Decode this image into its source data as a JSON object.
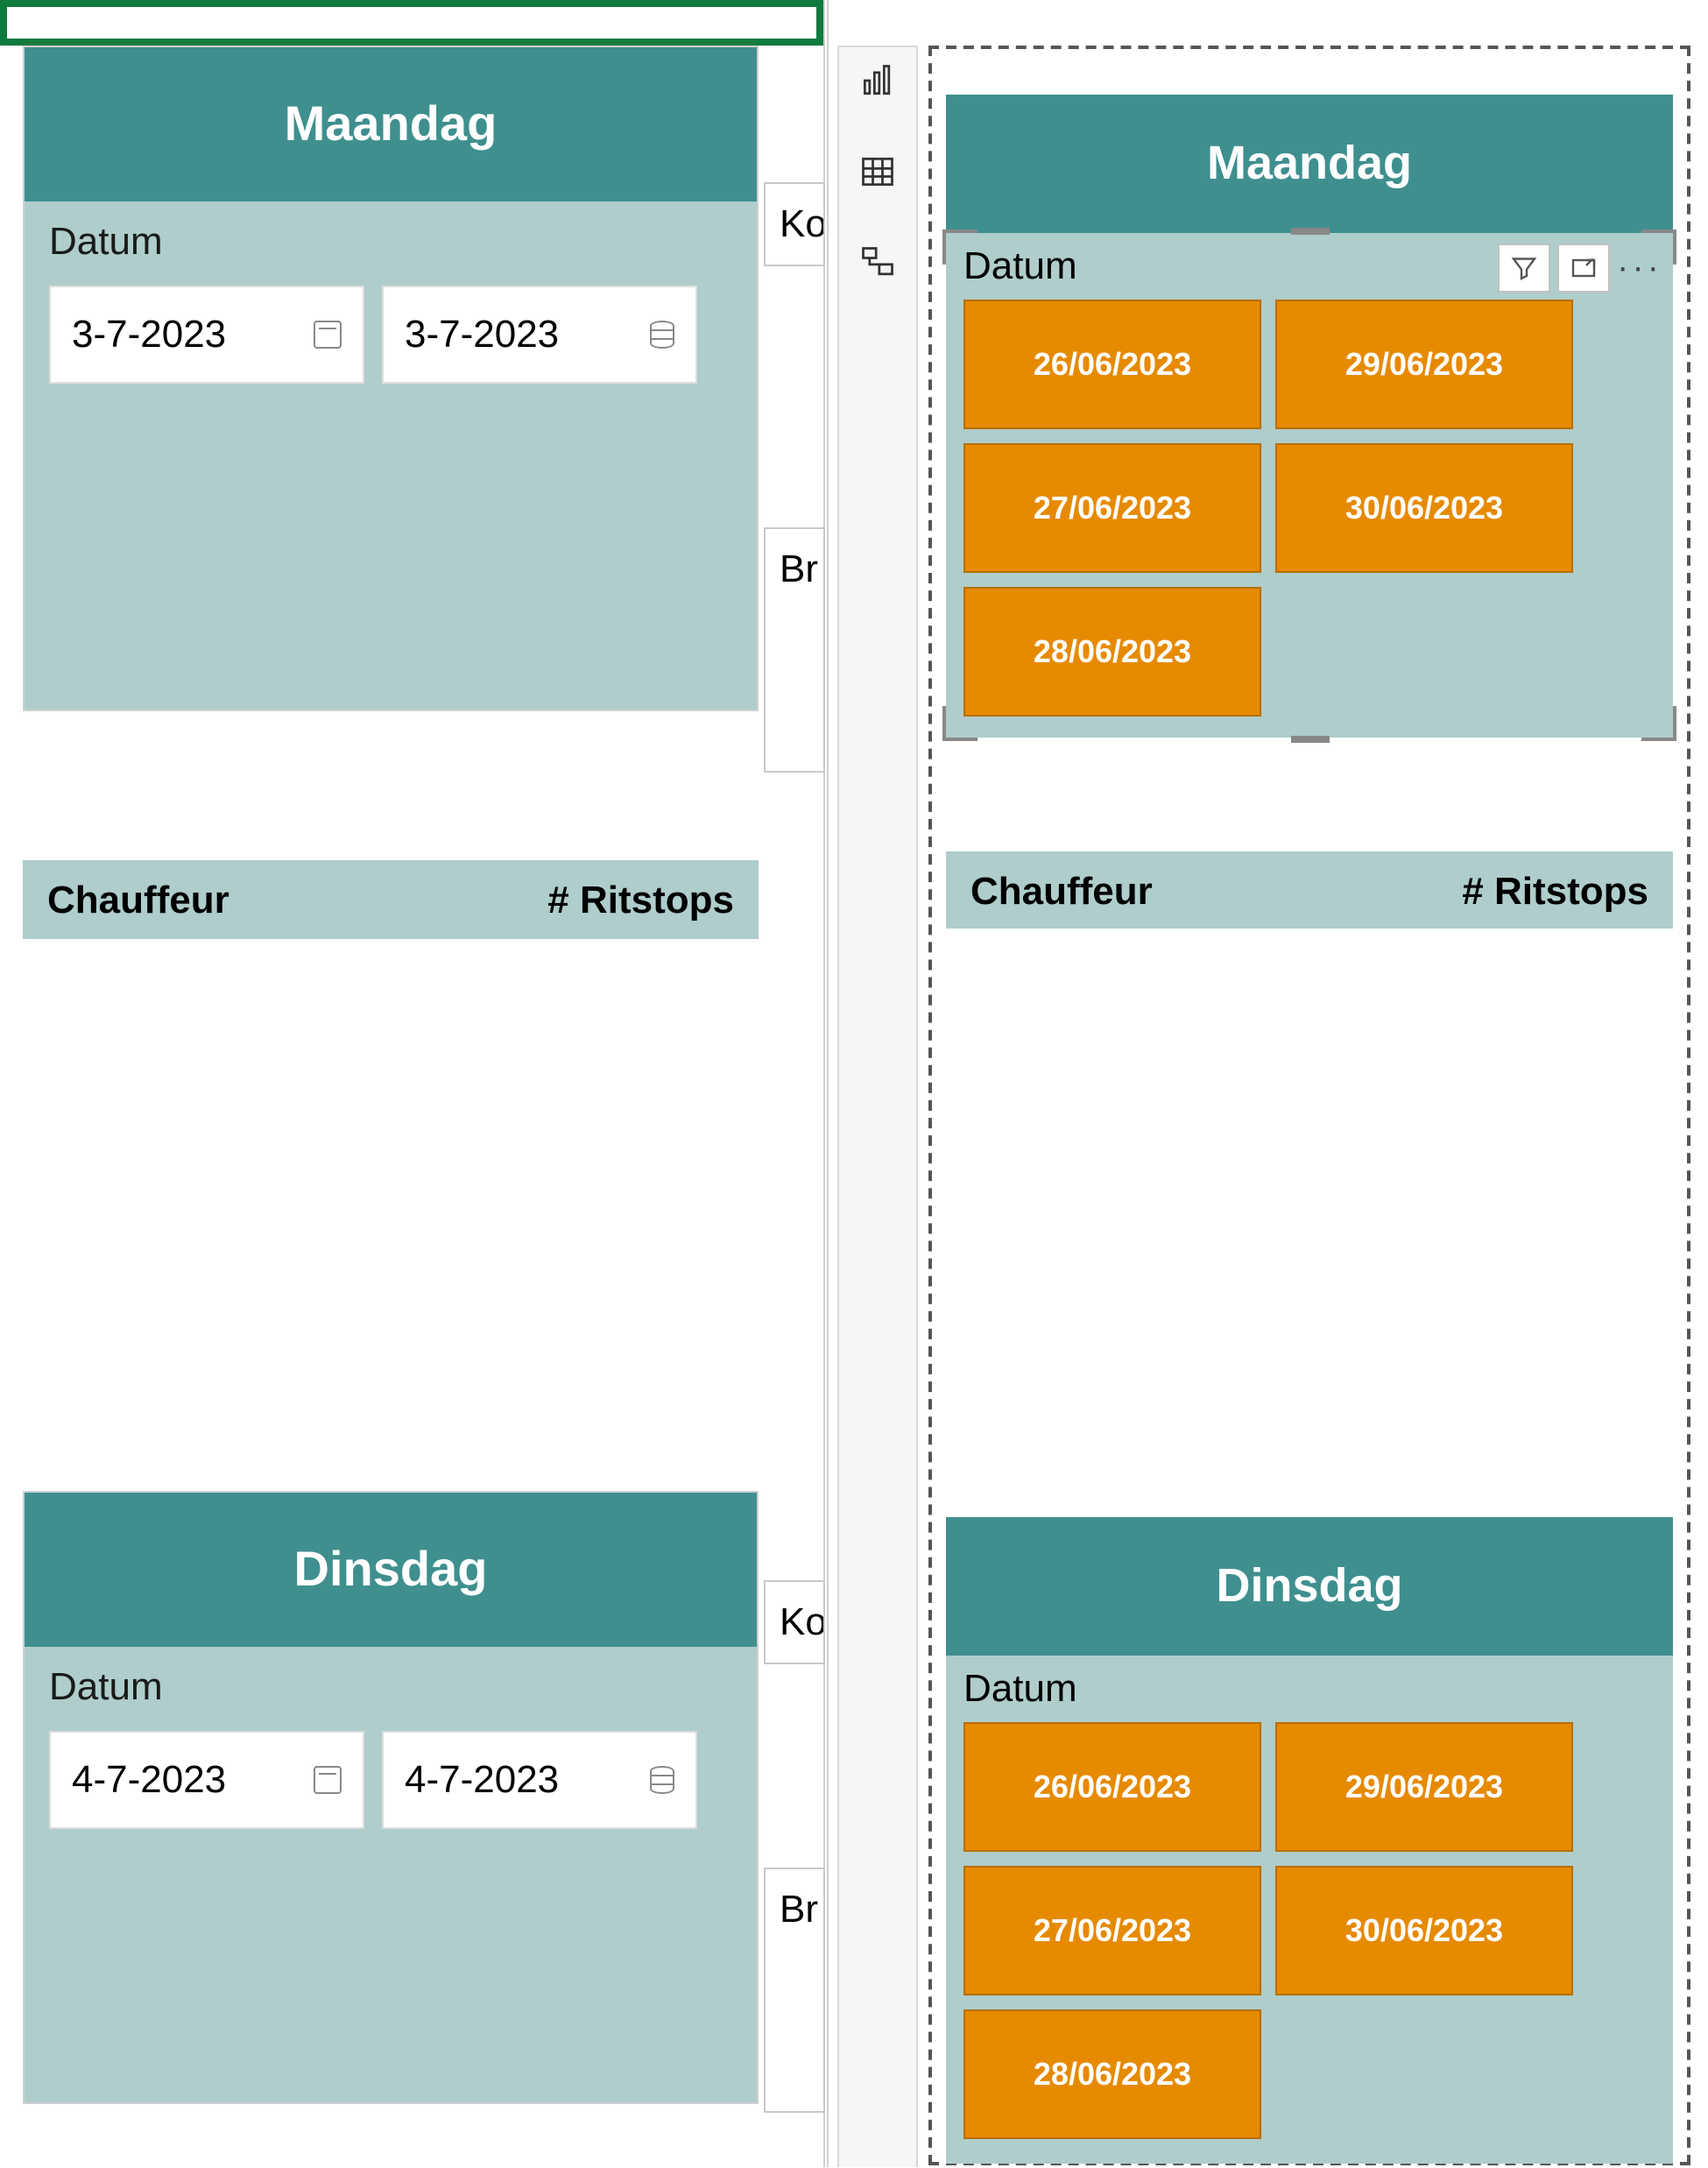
{
  "left": {
    "maandag": {
      "title": "Maandag",
      "datum_label": "Datum",
      "date_from": "3-7-2023",
      "date_to": "3-7-2023"
    },
    "dinsdag": {
      "title": "Dinsdag",
      "datum_label": "Datum",
      "date_from": "4-7-2023",
      "date_to": "4-7-2023"
    },
    "peek_ko": "Ko",
    "peek_br": "Br",
    "table_cols": {
      "c1": "Chauffeur",
      "c2": "# Ritstops"
    }
  },
  "right": {
    "maandag": {
      "title": "Maandag",
      "datum_label": "Datum",
      "tiles_col1": [
        "26/06/2023",
        "27/06/2023",
        "28/06/2023"
      ],
      "tiles_col2": [
        "29/06/2023",
        "30/06/2023"
      ]
    },
    "dinsdag": {
      "title": "Dinsdag",
      "datum_label": "Datum",
      "tiles_col1": [
        "26/06/2023",
        "27/06/2023",
        "28/06/2023"
      ],
      "tiles_col2": [
        "29/06/2023",
        "30/06/2023"
      ]
    },
    "table_cols": {
      "c1": "Chauffeur",
      "c2": "# Ritstops"
    }
  },
  "toolbar": {
    "chart": "chart",
    "table": "table",
    "model": "model"
  },
  "more_label": "···"
}
